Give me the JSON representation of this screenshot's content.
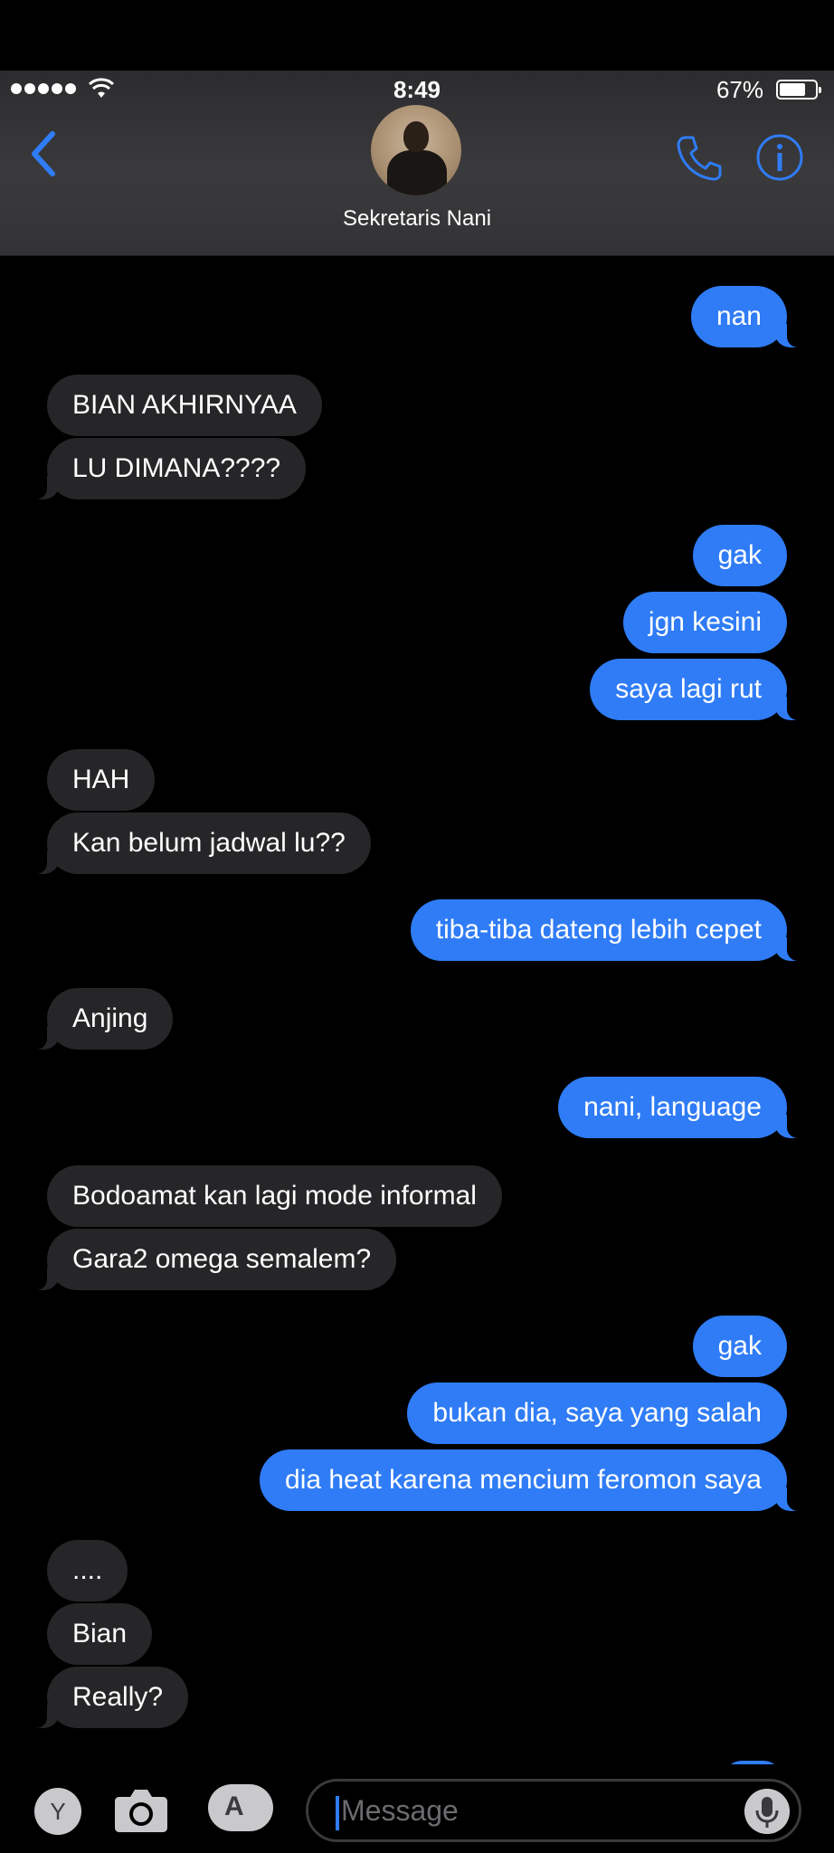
{
  "status": {
    "time": "8:49",
    "battery": "67%",
    "battery_level": 0.67
  },
  "header": {
    "contact_name": "Sekretaris Nani"
  },
  "messages": [
    {
      "dir": "out",
      "text": "nan"
    },
    {
      "dir": "in",
      "text": "BIAN AKHIRNYAA"
    },
    {
      "dir": "in",
      "text": "LU DIMANA????"
    },
    {
      "dir": "out",
      "text": "gak"
    },
    {
      "dir": "out",
      "text": "jgn kesini"
    },
    {
      "dir": "out",
      "text": "saya lagi rut"
    },
    {
      "dir": "in",
      "text": "HAH"
    },
    {
      "dir": "in",
      "text": "Kan belum jadwal lu??"
    },
    {
      "dir": "out",
      "text": "tiba-tiba dateng lebih cepet"
    },
    {
      "dir": "in",
      "text": "Anjing"
    },
    {
      "dir": "out",
      "text": "nani, language"
    },
    {
      "dir": "in",
      "text": "Bodoamat kan lagi mode informal"
    },
    {
      "dir": "in",
      "text": "Gara2 omega semalem?"
    },
    {
      "dir": "out",
      "text": "gak"
    },
    {
      "dir": "out",
      "text": "bukan dia, saya yang salah"
    },
    {
      "dir": "out",
      "text": "dia heat karena mencium feromon saya"
    },
    {
      "dir": "in",
      "text": "...."
    },
    {
      "dir": "in",
      "text": "Bian"
    },
    {
      "dir": "in",
      "text": "Really?"
    }
  ],
  "composer": {
    "app_label": "Y",
    "placeholder": "Message"
  },
  "colors": {
    "outgoing": "#2f7cf6",
    "incoming": "#262628",
    "accent": "#2f7cf6"
  },
  "icons": [
    "back-chevron-icon",
    "phone-icon",
    "info-icon",
    "wifi-icon",
    "camera-icon",
    "app-store-icon",
    "microphone-icon"
  ]
}
